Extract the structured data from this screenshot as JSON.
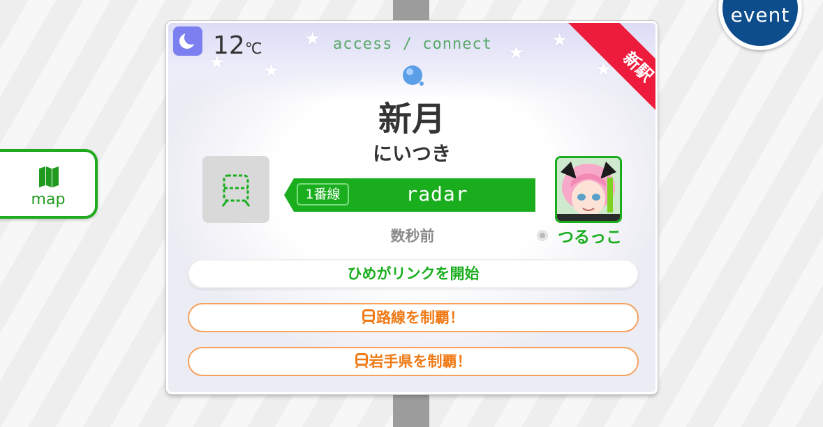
{
  "weather": {
    "icon": "moon-icon",
    "temperature": "12",
    "unit": "℃"
  },
  "header": {
    "subtitle": "access / connect"
  },
  "badge": {
    "label": "新駅",
    "color": "#ee1c3c"
  },
  "station": {
    "name": "新月",
    "reading": "にいつき",
    "icon": "water-drop-icon"
  },
  "line": {
    "number": "1番線",
    "name": "radar",
    "color": "#1aae1f"
  },
  "last_access": "数秒前",
  "user": {
    "name": "つるっこ",
    "avatar": "anime-girl-avatar"
  },
  "buttons": {
    "link": "ひめがリンクを開始",
    "conquer_line": "路線を制覇！",
    "conquer_prefecture": "岩手県を制覇！"
  },
  "side": {
    "map_label": "map",
    "event_label": "event"
  },
  "colors": {
    "accent": "#1aae1f",
    "orange": "#f07a16",
    "event_blue": "#0e4d8c",
    "moon_bg": "#7b7ff0"
  }
}
